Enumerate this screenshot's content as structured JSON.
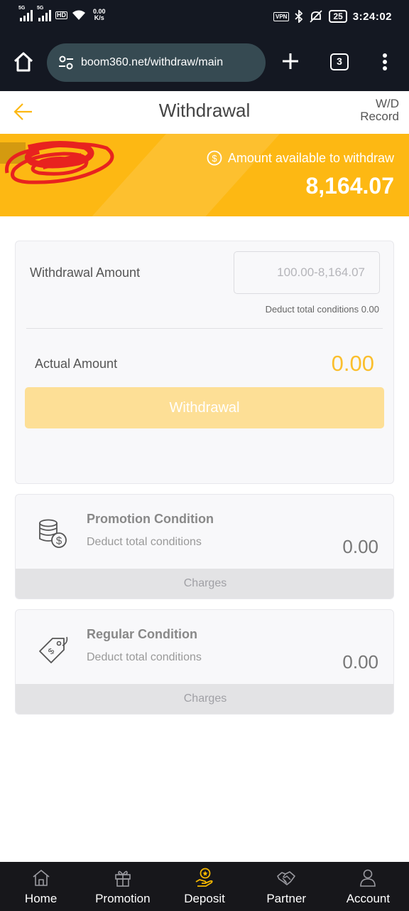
{
  "status_bar": {
    "sim1": "5G",
    "sim2": "5G",
    "hd": "HD",
    "net_speed_value": "0.00",
    "net_speed_unit": "K/s",
    "vpn": "VPN",
    "battery": "25",
    "time": "3:24:02"
  },
  "browser": {
    "url": "boom360.net/withdraw/main",
    "tab_count": "3"
  },
  "header": {
    "title": "Withdrawal",
    "record_line1": "W/D",
    "record_line2": "Record"
  },
  "banner": {
    "available_label": "Amount available to withdraw",
    "available_amount": "8,164.07"
  },
  "form": {
    "amount_label": "Withdrawal Amount",
    "amount_placeholder": "100.00-8,164.07",
    "deduct_total": "Deduct total conditions 0.00",
    "actual_label": "Actual Amount",
    "actual_value": "0.00",
    "submit_label": "Withdrawal"
  },
  "conditions": [
    {
      "title": "Promotion Condition",
      "subtitle": "Deduct total conditions",
      "value": "0.00",
      "button": "Charges"
    },
    {
      "title": "Regular Condition",
      "subtitle": "Deduct total conditions",
      "value": "0.00",
      "button": "Charges"
    }
  ],
  "nav": [
    {
      "label": "Home",
      "icon": "home-icon"
    },
    {
      "label": "Promotion",
      "icon": "gift-icon"
    },
    {
      "label": "Deposit",
      "icon": "deposit-icon",
      "active": true
    },
    {
      "label": "Partner",
      "icon": "handshake-icon"
    },
    {
      "label": "Account",
      "icon": "user-icon"
    }
  ],
  "colors": {
    "accent": "#fdb813",
    "amount_text": "#fbbf2d",
    "button_disabled": "#fddf96",
    "nav_active": "#f5b800",
    "status_bg": "#141822"
  }
}
